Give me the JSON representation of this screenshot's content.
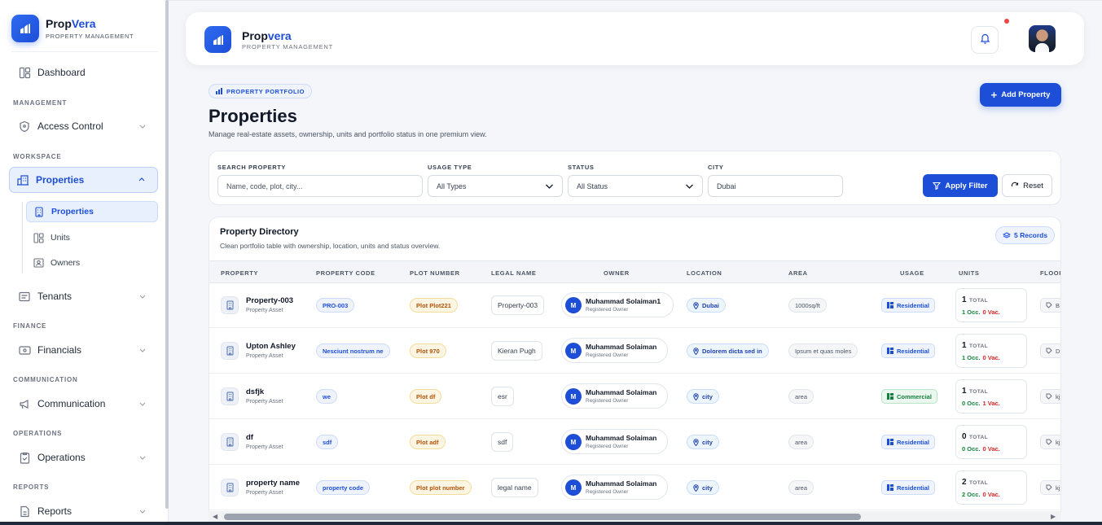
{
  "sidebar": {
    "brand_name_1": "Prop",
    "brand_name_2": "Vera",
    "brand_sub": "PROPERTY MANAGEMENT",
    "dashboard": "Dashboard",
    "sec_management": "MANAGEMENT",
    "access_control": "Access Control",
    "sec_workspace": "WORKSPACE",
    "properties": "Properties",
    "sub_properties": "Properties",
    "sub_units": "Units",
    "sub_owners": "Owners",
    "tenants": "Tenants",
    "sec_finance": "FINANCE",
    "financials": "Financials",
    "sec_communication": "COMMUNICATION",
    "communication": "Communication",
    "sec_operations": "OPERATIONS",
    "operations": "Operations",
    "sec_reports": "REPORTS",
    "reports": "Reports"
  },
  "header": {
    "name_1": "Prop",
    "name_2": "vera",
    "sub": "PROPERTY MANAGEMENT"
  },
  "page": {
    "crumb": "PROPERTY PORTFOLIO",
    "title": "Properties",
    "description": "Manage real-estate assets, ownership, units and portfolio status in one premium view.",
    "add_button": "Add Property"
  },
  "filters": {
    "search_label": "SEARCH PROPERTY",
    "search_placeholder": "Name, code, plot, city...",
    "usage_label": "USAGE TYPE",
    "usage_value": "All Types",
    "status_label": "STATUS",
    "status_value": "All Status",
    "city_label": "CITY",
    "city_value": "Dubai",
    "apply": "Apply Filter",
    "reset": "Reset"
  },
  "table": {
    "title": "Property Directory",
    "description": "Clean portfolio table with ownership, location, units and status overview.",
    "records": "5 Records",
    "headers": [
      "PROPERTY",
      "PROPERTY CODE",
      "PLOT NUMBER",
      "LEGAL NAME",
      "OWNER",
      "LOCATION",
      "AREA",
      "USAGE",
      "UNITS",
      "FLOOR"
    ],
    "total_label": "TOTAL",
    "rows": [
      {
        "name": "Property-003",
        "sub": "Property Asset",
        "code": "PRO-003",
        "plot": "Plot Plot221",
        "legal": "Property-003",
        "owner": "Muhammad Solaiman1",
        "owner_sub": "Registered Owner",
        "owner_initial": "M",
        "location": "Dubai",
        "area": "1000sq/ft",
        "usage": "Residential",
        "total": "1",
        "occ": "1 Occ.",
        "vac": "0 Vac.",
        "floor": "B"
      },
      {
        "name": "Upton Ashley",
        "sub": "Property Asset",
        "code": "Nesciunt nostrum ne",
        "plot": "Plot 970",
        "legal": "Kieran Pugh",
        "owner": "Muhammad Solaiman",
        "owner_sub": "Registered Owner",
        "owner_initial": "M",
        "location": "Dolorem dicta sed in",
        "area": "Ipsum et quas moles",
        "usage": "Residential",
        "total": "1",
        "occ": "1 Occ.",
        "vac": "0 Vac.",
        "floor": "D"
      },
      {
        "name": "dsfjk",
        "sub": "Property Asset",
        "code": "we",
        "plot": "Plot df",
        "legal": "esr",
        "owner": "Muhammad Solaiman",
        "owner_sub": "Registered Owner",
        "owner_initial": "M",
        "location": "city",
        "area": "area",
        "usage": "Commercial",
        "total": "1",
        "occ": "0 Occ.",
        "vac": "1 Vac.",
        "floor": "kj"
      },
      {
        "name": "df",
        "sub": "Property Asset",
        "code": "sdf",
        "plot": "Plot adf",
        "legal": "sdf",
        "owner": "Muhammad Solaiman",
        "owner_sub": "Registered Owner",
        "owner_initial": "M",
        "location": "city",
        "area": "area",
        "usage": "Residential",
        "total": "0",
        "occ": "0 Occ.",
        "vac": "0 Vac.",
        "floor": "kj"
      },
      {
        "name": "property name",
        "sub": "Property Asset",
        "code": "property code",
        "plot": "Plot plot number",
        "legal": "legal name",
        "owner": "Muhammad Solaiman",
        "owner_sub": "Registered Owner",
        "owner_initial": "M",
        "location": "city",
        "area": "area",
        "usage": "Residential",
        "total": "2",
        "occ": "2 Occ.",
        "vac": "0 Vac.",
        "floor": "kj"
      }
    ]
  },
  "colors": {
    "accent": "#1d4ed8",
    "occupied": "#15803d",
    "vacant": "#dc2626",
    "notification_dot": "#ef4444"
  },
  "icons": {
    "logo": "building-chart-icon",
    "bell": "bell-icon",
    "search": "search-icon",
    "filter": "filter-icon",
    "reset": "refresh-icon",
    "location": "map-pin-icon",
    "records": "layers-icon"
  }
}
